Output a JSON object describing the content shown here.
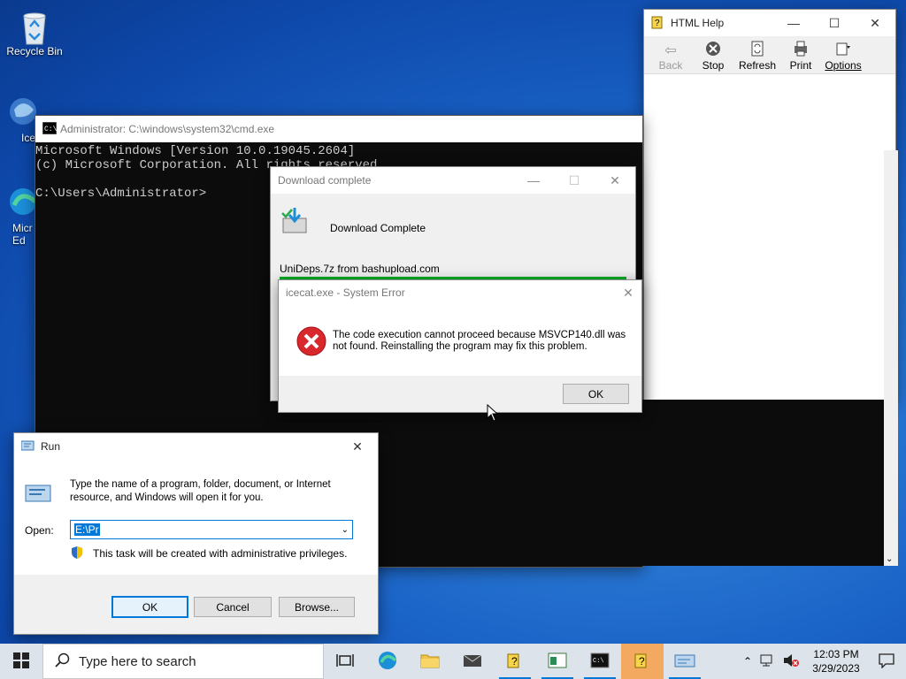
{
  "desktop": {
    "icons": [
      {
        "label": "Recycle Bin"
      },
      {
        "label": "Ice"
      },
      {
        "label": "Micr\nEd"
      }
    ]
  },
  "html_help": {
    "title": "HTML Help",
    "toolbar": {
      "back": "Back",
      "stop": "Stop",
      "refresh": "Refresh",
      "print": "Print",
      "options": "Options"
    }
  },
  "cmd": {
    "title": "Administrator: C:\\windows\\system32\\cmd.exe",
    "lines": "Microsoft Windows [Version 10.0.19045.2604]\n(c) Microsoft Corporation. All rights reserved.\n\nC:\\Users\\Administrator>"
  },
  "download": {
    "title": "Download complete",
    "heading": "Download Complete",
    "file_text": "UniDeps.7z from bashupload.com"
  },
  "error": {
    "title": "icecat.exe - System Error",
    "message": "The code execution cannot proceed because MSVCP140.dll was not found. Reinstalling the program may fix this problem.",
    "ok": "OK"
  },
  "run": {
    "title": "Run",
    "description": "Type the name of a program, folder, document, or Internet resource, and Windows will open it for you.",
    "open_label": "Open:",
    "open_value": "E:\\Pr",
    "admin_note": "This task will be created with administrative privileges.",
    "ok": "OK",
    "cancel": "Cancel",
    "browse": "Browse..."
  },
  "taskbar": {
    "search_placeholder": "Type here to search",
    "time": "12:03 PM",
    "date": "3/29/2023"
  },
  "colors": {
    "accent": "#0078d7",
    "progress": "#06b025",
    "error_red": "#d9272e",
    "active_task": "#f4a960"
  }
}
